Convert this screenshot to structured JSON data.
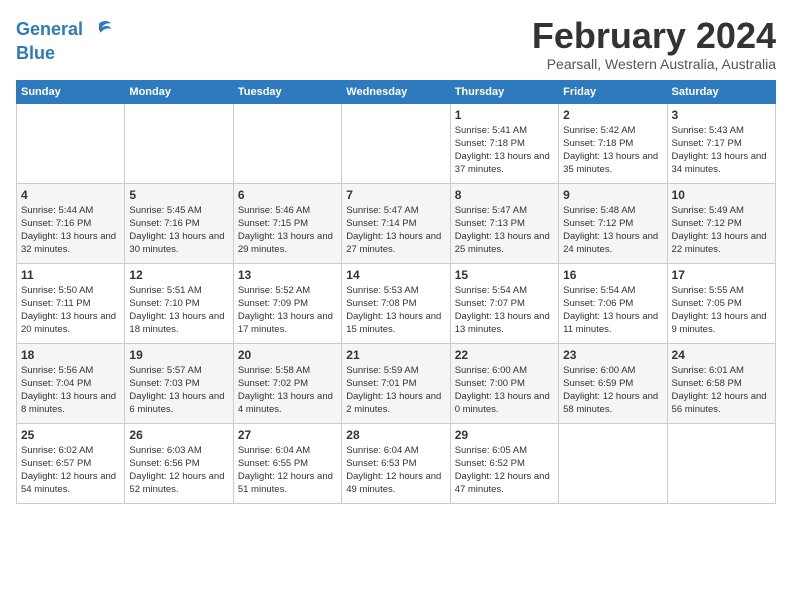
{
  "header": {
    "logo_line1": "General",
    "logo_line2": "Blue",
    "month_year": "February 2024",
    "location": "Pearsall, Western Australia, Australia"
  },
  "weekdays": [
    "Sunday",
    "Monday",
    "Tuesday",
    "Wednesday",
    "Thursday",
    "Friday",
    "Saturday"
  ],
  "weeks": [
    [
      {
        "day": "",
        "sunrise": "",
        "sunset": "",
        "daylight": ""
      },
      {
        "day": "",
        "sunrise": "",
        "sunset": "",
        "daylight": ""
      },
      {
        "day": "",
        "sunrise": "",
        "sunset": "",
        "daylight": ""
      },
      {
        "day": "",
        "sunrise": "",
        "sunset": "",
        "daylight": ""
      },
      {
        "day": "1",
        "sunrise": "Sunrise: 5:41 AM",
        "sunset": "Sunset: 7:18 PM",
        "daylight": "Daylight: 13 hours and 37 minutes."
      },
      {
        "day": "2",
        "sunrise": "Sunrise: 5:42 AM",
        "sunset": "Sunset: 7:18 PM",
        "daylight": "Daylight: 13 hours and 35 minutes."
      },
      {
        "day": "3",
        "sunrise": "Sunrise: 5:43 AM",
        "sunset": "Sunset: 7:17 PM",
        "daylight": "Daylight: 13 hours and 34 minutes."
      }
    ],
    [
      {
        "day": "4",
        "sunrise": "Sunrise: 5:44 AM",
        "sunset": "Sunset: 7:16 PM",
        "daylight": "Daylight: 13 hours and 32 minutes."
      },
      {
        "day": "5",
        "sunrise": "Sunrise: 5:45 AM",
        "sunset": "Sunset: 7:16 PM",
        "daylight": "Daylight: 13 hours and 30 minutes."
      },
      {
        "day": "6",
        "sunrise": "Sunrise: 5:46 AM",
        "sunset": "Sunset: 7:15 PM",
        "daylight": "Daylight: 13 hours and 29 minutes."
      },
      {
        "day": "7",
        "sunrise": "Sunrise: 5:47 AM",
        "sunset": "Sunset: 7:14 PM",
        "daylight": "Daylight: 13 hours and 27 minutes."
      },
      {
        "day": "8",
        "sunrise": "Sunrise: 5:47 AM",
        "sunset": "Sunset: 7:13 PM",
        "daylight": "Daylight: 13 hours and 25 minutes."
      },
      {
        "day": "9",
        "sunrise": "Sunrise: 5:48 AM",
        "sunset": "Sunset: 7:12 PM",
        "daylight": "Daylight: 13 hours and 24 minutes."
      },
      {
        "day": "10",
        "sunrise": "Sunrise: 5:49 AM",
        "sunset": "Sunset: 7:12 PM",
        "daylight": "Daylight: 13 hours and 22 minutes."
      }
    ],
    [
      {
        "day": "11",
        "sunrise": "Sunrise: 5:50 AM",
        "sunset": "Sunset: 7:11 PM",
        "daylight": "Daylight: 13 hours and 20 minutes."
      },
      {
        "day": "12",
        "sunrise": "Sunrise: 5:51 AM",
        "sunset": "Sunset: 7:10 PM",
        "daylight": "Daylight: 13 hours and 18 minutes."
      },
      {
        "day": "13",
        "sunrise": "Sunrise: 5:52 AM",
        "sunset": "Sunset: 7:09 PM",
        "daylight": "Daylight: 13 hours and 17 minutes."
      },
      {
        "day": "14",
        "sunrise": "Sunrise: 5:53 AM",
        "sunset": "Sunset: 7:08 PM",
        "daylight": "Daylight: 13 hours and 15 minutes."
      },
      {
        "day": "15",
        "sunrise": "Sunrise: 5:54 AM",
        "sunset": "Sunset: 7:07 PM",
        "daylight": "Daylight: 13 hours and 13 minutes."
      },
      {
        "day": "16",
        "sunrise": "Sunrise: 5:54 AM",
        "sunset": "Sunset: 7:06 PM",
        "daylight": "Daylight: 13 hours and 11 minutes."
      },
      {
        "day": "17",
        "sunrise": "Sunrise: 5:55 AM",
        "sunset": "Sunset: 7:05 PM",
        "daylight": "Daylight: 13 hours and 9 minutes."
      }
    ],
    [
      {
        "day": "18",
        "sunrise": "Sunrise: 5:56 AM",
        "sunset": "Sunset: 7:04 PM",
        "daylight": "Daylight: 13 hours and 8 minutes."
      },
      {
        "day": "19",
        "sunrise": "Sunrise: 5:57 AM",
        "sunset": "Sunset: 7:03 PM",
        "daylight": "Daylight: 13 hours and 6 minutes."
      },
      {
        "day": "20",
        "sunrise": "Sunrise: 5:58 AM",
        "sunset": "Sunset: 7:02 PM",
        "daylight": "Daylight: 13 hours and 4 minutes."
      },
      {
        "day": "21",
        "sunrise": "Sunrise: 5:59 AM",
        "sunset": "Sunset: 7:01 PM",
        "daylight": "Daylight: 13 hours and 2 minutes."
      },
      {
        "day": "22",
        "sunrise": "Sunrise: 6:00 AM",
        "sunset": "Sunset: 7:00 PM",
        "daylight": "Daylight: 13 hours and 0 minutes."
      },
      {
        "day": "23",
        "sunrise": "Sunrise: 6:00 AM",
        "sunset": "Sunset: 6:59 PM",
        "daylight": "Daylight: 12 hours and 58 minutes."
      },
      {
        "day": "24",
        "sunrise": "Sunrise: 6:01 AM",
        "sunset": "Sunset: 6:58 PM",
        "daylight": "Daylight: 12 hours and 56 minutes."
      }
    ],
    [
      {
        "day": "25",
        "sunrise": "Sunrise: 6:02 AM",
        "sunset": "Sunset: 6:57 PM",
        "daylight": "Daylight: 12 hours and 54 minutes."
      },
      {
        "day": "26",
        "sunrise": "Sunrise: 6:03 AM",
        "sunset": "Sunset: 6:56 PM",
        "daylight": "Daylight: 12 hours and 52 minutes."
      },
      {
        "day": "27",
        "sunrise": "Sunrise: 6:04 AM",
        "sunset": "Sunset: 6:55 PM",
        "daylight": "Daylight: 12 hours and 51 minutes."
      },
      {
        "day": "28",
        "sunrise": "Sunrise: 6:04 AM",
        "sunset": "Sunset: 6:53 PM",
        "daylight": "Daylight: 12 hours and 49 minutes."
      },
      {
        "day": "29",
        "sunrise": "Sunrise: 6:05 AM",
        "sunset": "Sunset: 6:52 PM",
        "daylight": "Daylight: 12 hours and 47 minutes."
      },
      {
        "day": "",
        "sunrise": "",
        "sunset": "",
        "daylight": ""
      },
      {
        "day": "",
        "sunrise": "",
        "sunset": "",
        "daylight": ""
      }
    ]
  ]
}
